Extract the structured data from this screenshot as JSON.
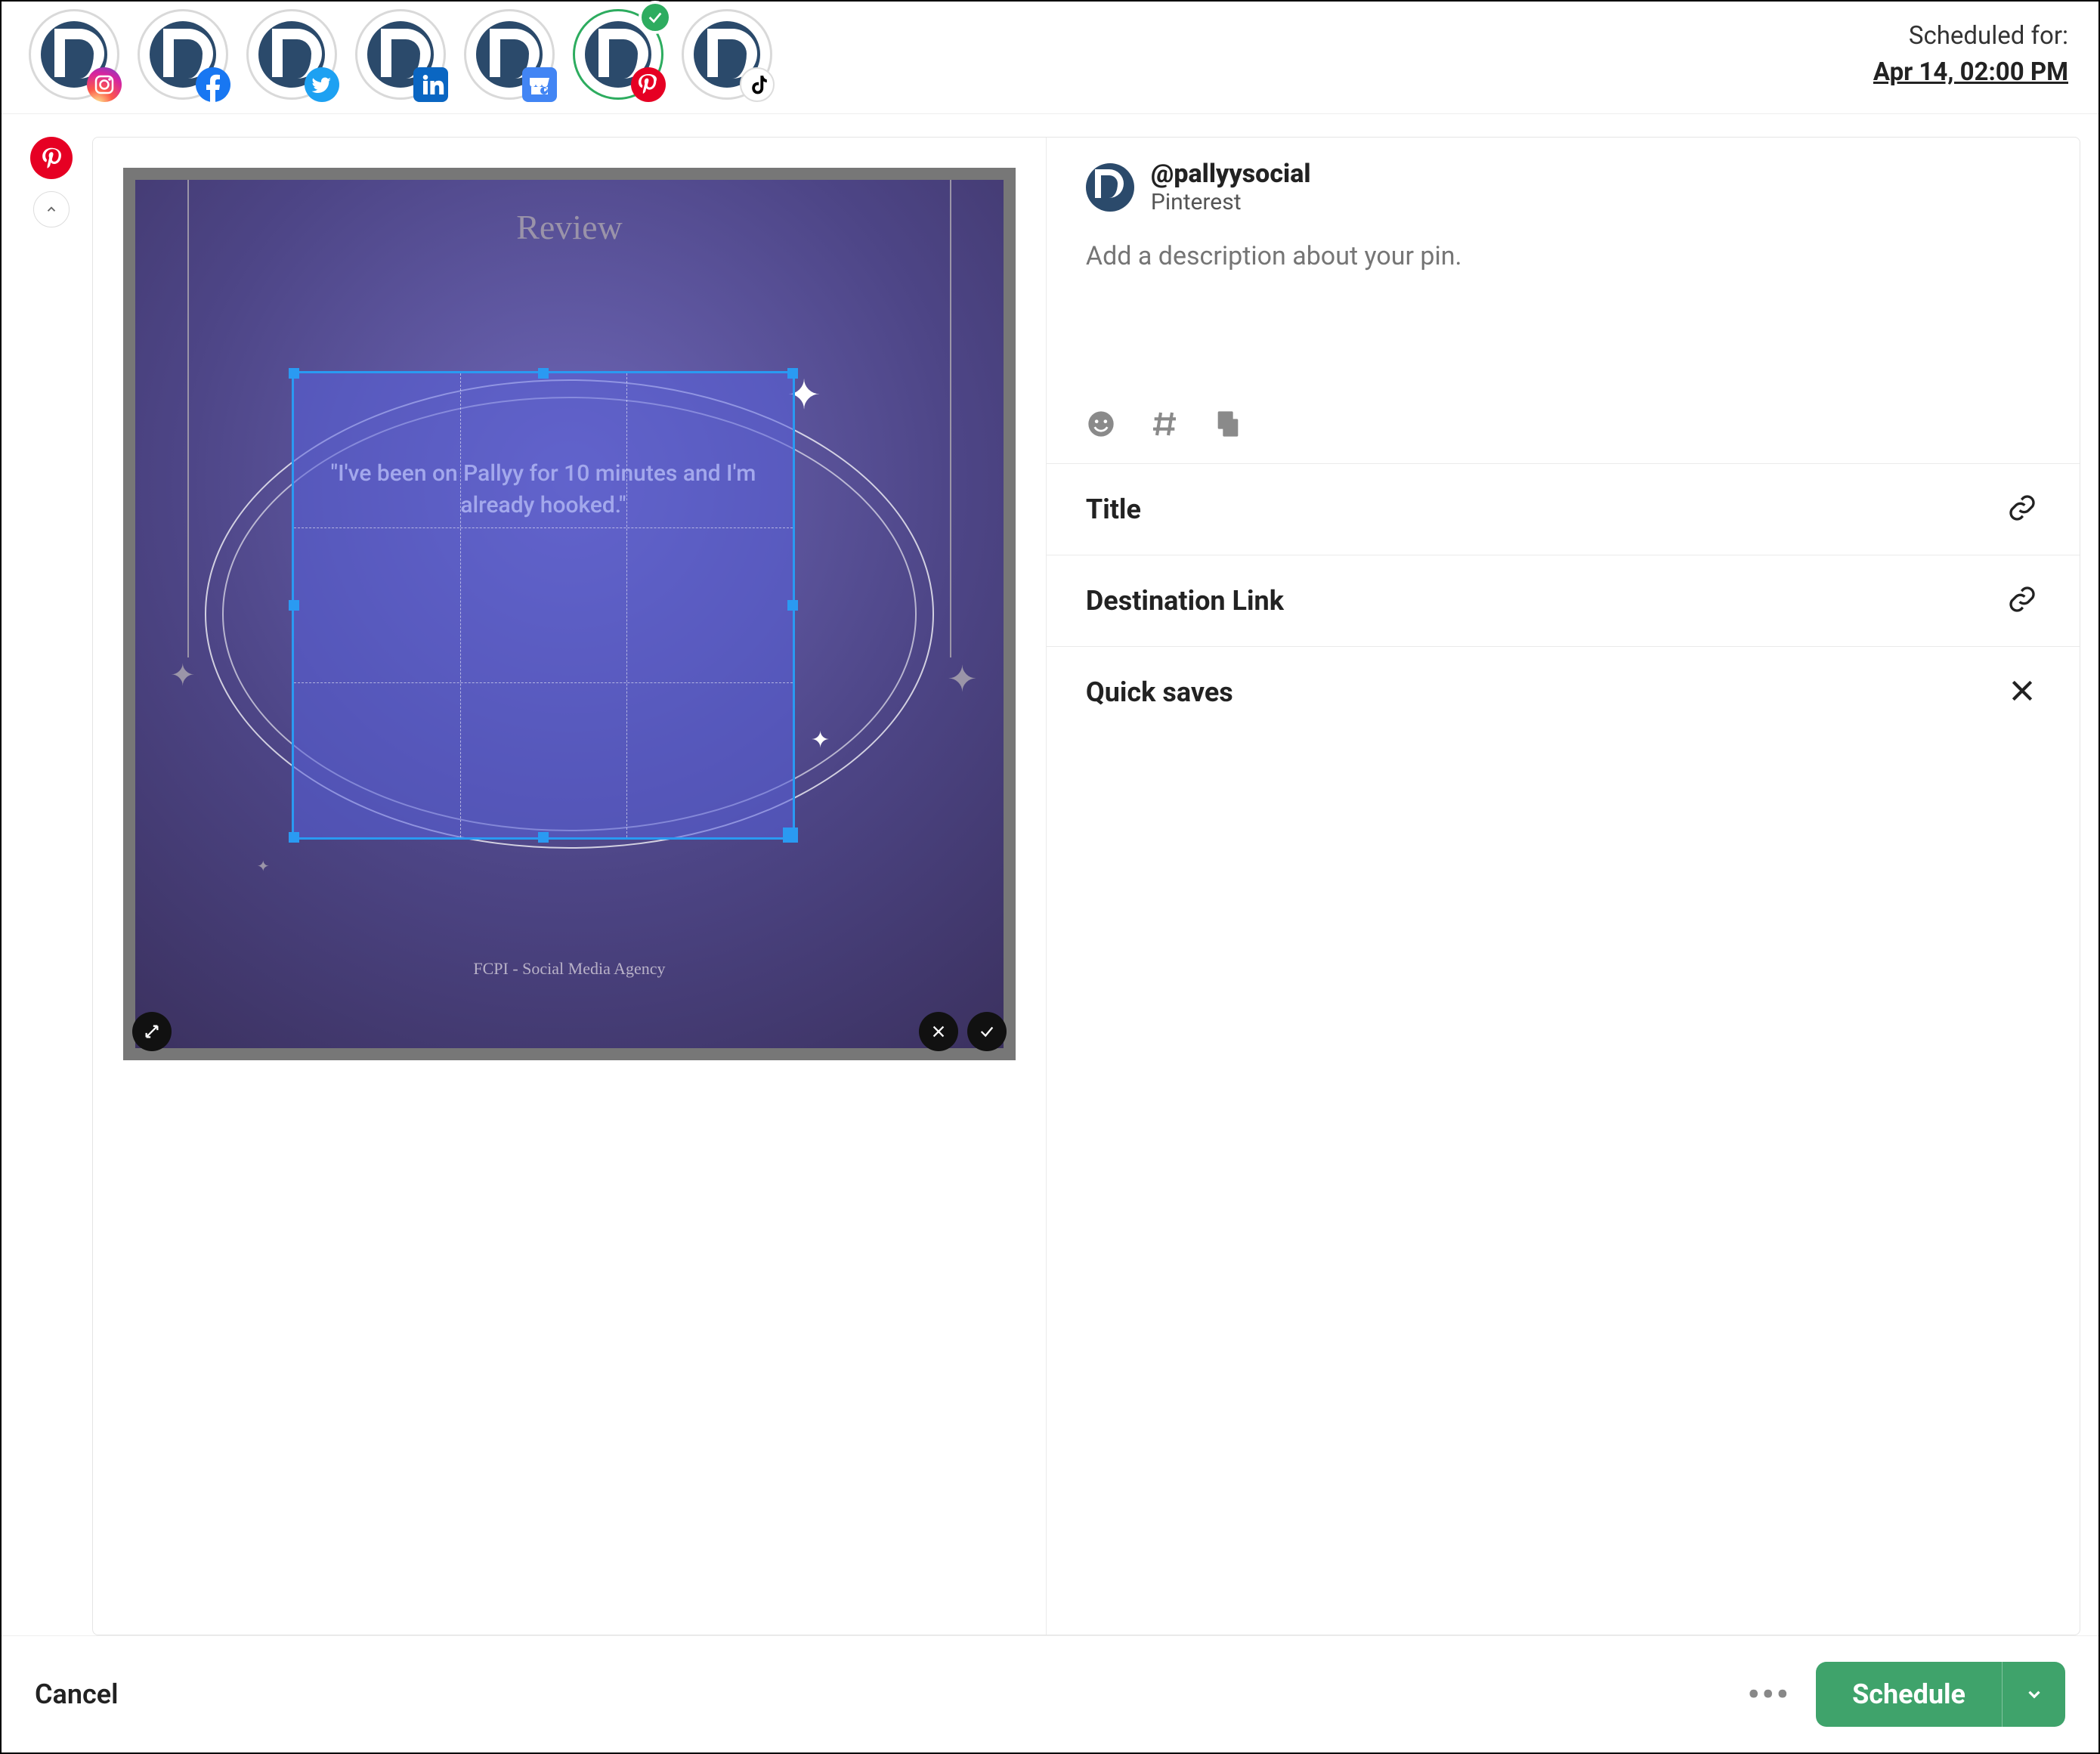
{
  "header": {
    "scheduled_label": "Scheduled for:",
    "scheduled_time": "Apr 14, 02:00 PM",
    "accounts": [
      {
        "network": "instagram",
        "selected": false
      },
      {
        "network": "facebook",
        "selected": false
      },
      {
        "network": "twitter",
        "selected": false
      },
      {
        "network": "linkedin",
        "selected": false
      },
      {
        "network": "google",
        "selected": false
      },
      {
        "network": "pinterest",
        "selected": true
      },
      {
        "network": "tiktok",
        "selected": false
      }
    ]
  },
  "rail": {
    "active_network": "pinterest"
  },
  "preview": {
    "title": "Review",
    "quote": "\"I've been on Pallyy for 10 minutes and I'm already hooked.\"",
    "agency": "FCPI - Social Media Agency"
  },
  "account": {
    "handle": "@pallyysocial",
    "platform": "Pinterest"
  },
  "composer": {
    "description_placeholder": "Add a description about your pin.",
    "tools": {
      "emoji": "emoji",
      "hashtag": "hashtag",
      "copy": "copy"
    }
  },
  "fields": {
    "title_label": "Title",
    "destination_label": "Destination Link",
    "quick_saves_label": "Quick saves"
  },
  "footer": {
    "cancel": "Cancel",
    "schedule": "Schedule"
  },
  "colors": {
    "accent_green": "#3fa36b",
    "pinterest_red": "#e60023"
  }
}
